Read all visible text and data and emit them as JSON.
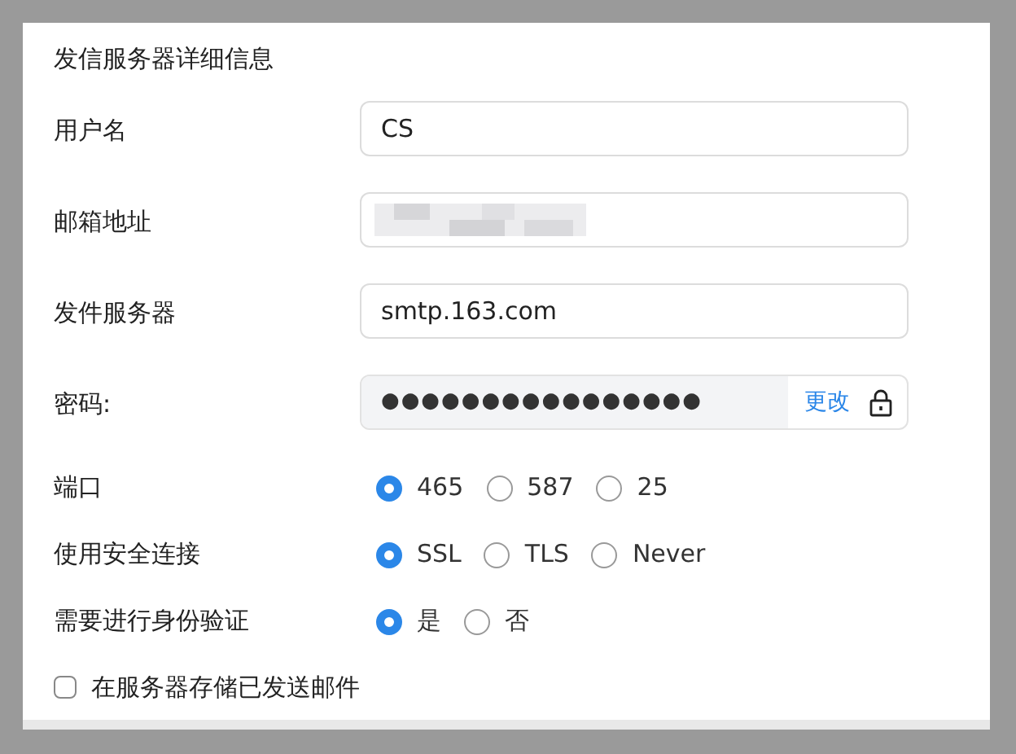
{
  "title": "发信服务器详细信息",
  "fields": [
    {
      "kind": "text",
      "label": "用户名",
      "value": "CS"
    },
    {
      "kind": "redacted",
      "label": "邮箱地址"
    },
    {
      "kind": "text",
      "label": "发件服务器",
      "value": "smtp.163.com"
    },
    {
      "kind": "password",
      "label": "密码:",
      "value": "●●●●●●●●●●●●●●●●",
      "action": "更改"
    }
  ],
  "radio_groups": [
    {
      "label": "端口",
      "options": [
        {
          "label": "465",
          "selected": true
        },
        {
          "label": "587",
          "selected": false
        },
        {
          "label": "25",
          "selected": false
        }
      ]
    },
    {
      "label": "使用安全连接",
      "options": [
        {
          "label": "SSL",
          "selected": true
        },
        {
          "label": "TLS",
          "selected": false
        },
        {
          "label": "Never",
          "selected": false
        }
      ]
    },
    {
      "label": "需要进行身份验证",
      "options": [
        {
          "label": "是",
          "selected": true
        },
        {
          "label": "否",
          "selected": false
        }
      ]
    }
  ],
  "checkbox": {
    "label": "在服务器存储已发送邮件",
    "checked": false
  }
}
